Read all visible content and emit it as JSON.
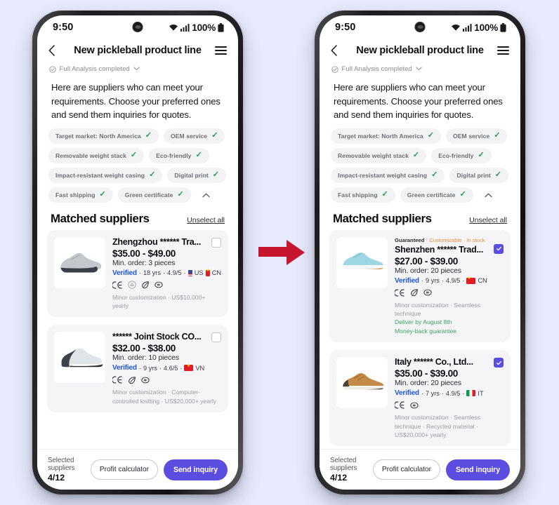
{
  "background_color": "#e7eafc",
  "arrow": {
    "color": "#c8152f",
    "name": "transition-arrow"
  },
  "status_bar": {
    "time": "9:50",
    "battery": "100%"
  },
  "header": {
    "title": "New pickleball product line",
    "back_label": "Back",
    "menu_label": "Menu"
  },
  "analysis": {
    "text": "Full Analysis completed"
  },
  "intro": "Here are suppliers who can meet your requirements. Choose your preferred ones and send them inquiries for quotes.",
  "chips": [
    "Target market: North America",
    "OEM service",
    "Removable weight stack",
    "Eco-friendly",
    "Impact-resistant weight casing",
    "Digital print",
    "Fast shipping",
    "Green certificate"
  ],
  "matched": {
    "title": "Matched suppliers",
    "unselect_all": "Unselect all"
  },
  "bottom": {
    "selected_label": "Selected suppliers",
    "selected_value": "4/12",
    "profit_calculator": "Profit calculator",
    "send_inquiry": "Send inquiry"
  },
  "left_phone": {
    "cards": [
      {
        "badges": null,
        "name": "Zhengzhou ****** Tra...",
        "price": "$35.00 - $49.00",
        "moq": "Min. order: 3 pieces",
        "verified": "Verified",
        "years": "18 yrs",
        "rating": "4.9/5",
        "countries": [
          {
            "flag": "us",
            "code": "US"
          },
          {
            "flag": "cn",
            "code": "CN"
          }
        ],
        "certs": [
          "ce-mark-icon",
          "recycle-icon",
          "leaf-icon",
          "circle-mark-icon"
        ],
        "footer": "Minor customization · US$10,000+ yearly",
        "green_lines": [],
        "checked": false,
        "shoe_color": "#b9bcc0"
      },
      {
        "badges": null,
        "name": "****** Joint Stock CO...",
        "price": "$32.00 - $38.00",
        "moq": "Min. order: 10 pieces",
        "verified": "Verified",
        "years": "9 yrs",
        "rating": "4.6/5",
        "countries": [
          {
            "flag": "vn",
            "code": "VN"
          }
        ],
        "certs": [
          "ce-mark-icon",
          "leaf-icon",
          "circle-mark-icon"
        ],
        "footer": "Minor customization · Computer-controlled knitting · US$20,000+ yearly",
        "green_lines": [],
        "checked": false,
        "shoe_color": "#8e979c"
      }
    ]
  },
  "right_phone": {
    "cards": [
      {
        "badges": {
          "guaranteed": "Guaranteed",
          "rest": " · Customizable · In stock"
        },
        "name": "Shenzhen ****** Trad...",
        "price": "$27.00 - $39.00",
        "moq": "Min. order: 20 pieces",
        "verified": "Verified",
        "years": "9 yrs",
        "rating": "4.9/5",
        "countries": [
          {
            "flag": "cn",
            "code": "CN"
          }
        ],
        "certs": [
          "ce-mark-icon",
          "leaf-icon",
          "circle-mark-icon"
        ],
        "footer": "Minor customization · Seamless technique",
        "green_lines": [
          "Deliver by August 8th",
          "Money-back guarantee"
        ],
        "checked": true,
        "shoe_color": "#8fd1e0"
      },
      {
        "badges": null,
        "name": "Italy ****** Co., Ltd...",
        "price": "$35.00 - $39.00",
        "moq": "Min. order: 20 pieces",
        "verified": "Verified",
        "years": "7 yrs",
        "rating": "4.9/5",
        "countries": [
          {
            "flag": "it",
            "code": "IT"
          }
        ],
        "certs": [
          "ce-mark-icon",
          "circle-mark-icon"
        ],
        "footer": "Minor customization · Seamless technique · Recycled material · US$20,000+ yearly",
        "green_lines": [],
        "checked": true,
        "shoe_color": "#c08a44"
      }
    ]
  }
}
